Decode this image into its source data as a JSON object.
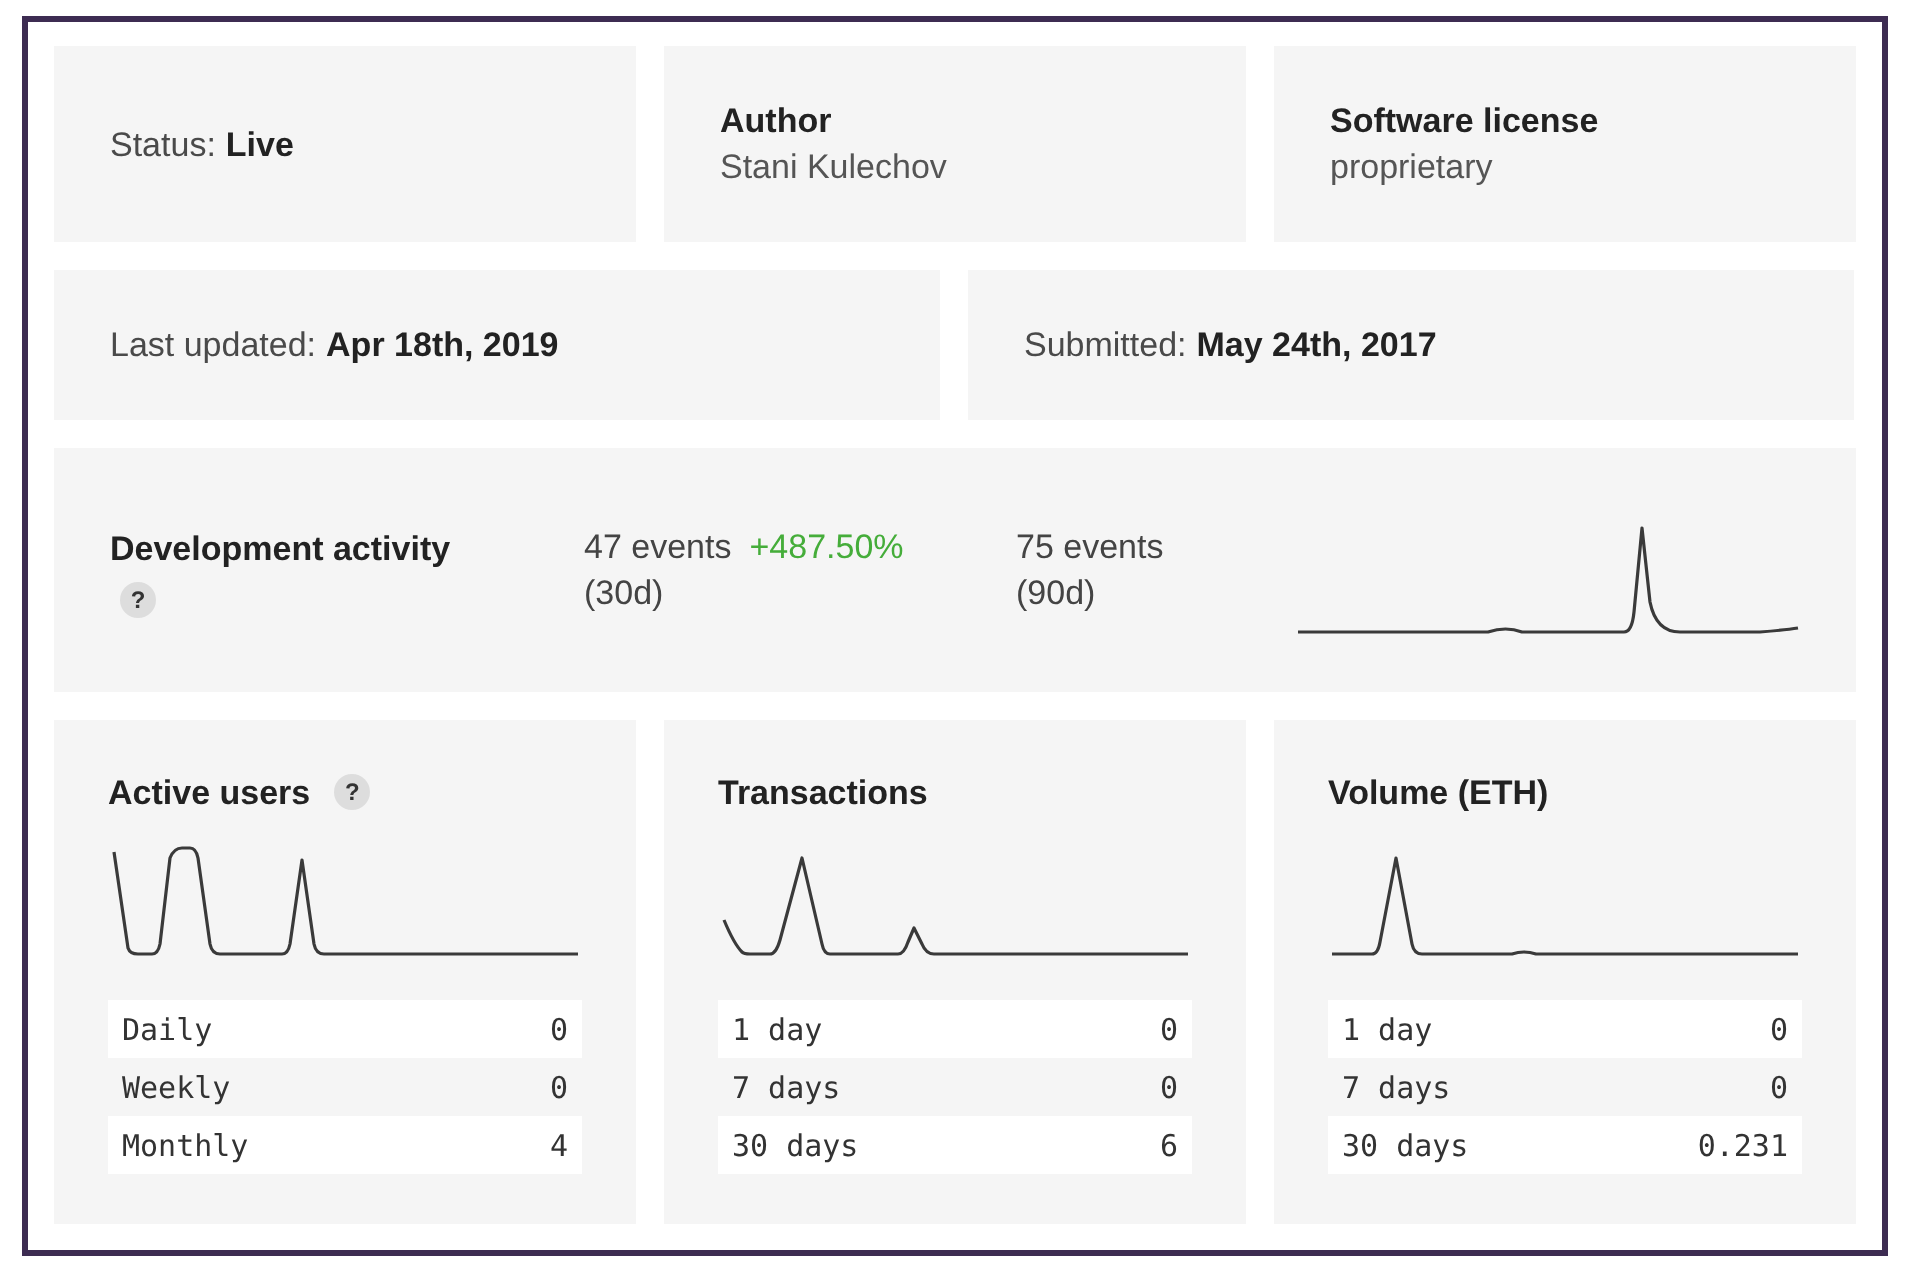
{
  "info_row": [
    {
      "kind": "inline",
      "label": "Status:",
      "value": "Live"
    },
    {
      "kind": "stacked",
      "label": "Author",
      "value": "Stani Kulechov"
    },
    {
      "kind": "stacked",
      "label": "Software license",
      "value": "proprietary"
    }
  ],
  "dates_row": [
    {
      "kind": "inline",
      "label": "Last updated:",
      "value": "Apr 18th, 2019"
    },
    {
      "kind": "inline",
      "label": "Submitted:",
      "value": "May 24th, 2017"
    }
  ],
  "development_activity": {
    "title": "Development activity",
    "help": "?",
    "stats": [
      {
        "count": "47 events",
        "change": "+487.50%",
        "period": "(30d)"
      },
      {
        "count": "75 events",
        "period": "(90d)"
      }
    ]
  },
  "metric_cards": [
    {
      "title": "Active users",
      "help": "?",
      "rows": [
        {
          "label": "Daily",
          "value": "0"
        },
        {
          "label": "Weekly",
          "value": "0"
        },
        {
          "label": "Monthly",
          "value": "4"
        }
      ]
    },
    {
      "title": "Transactions",
      "rows": [
        {
          "label": "1 day",
          "value": "0"
        },
        {
          "label": "7 days",
          "value": "0"
        },
        {
          "label": "30 days",
          "value": "6"
        }
      ]
    },
    {
      "title": "Volume (ETH)",
      "rows": [
        {
          "label": "1 day",
          "value": "0"
        },
        {
          "label": "7 days",
          "value": "0"
        },
        {
          "label": "30 days",
          "value": "0.231"
        }
      ]
    }
  ]
}
